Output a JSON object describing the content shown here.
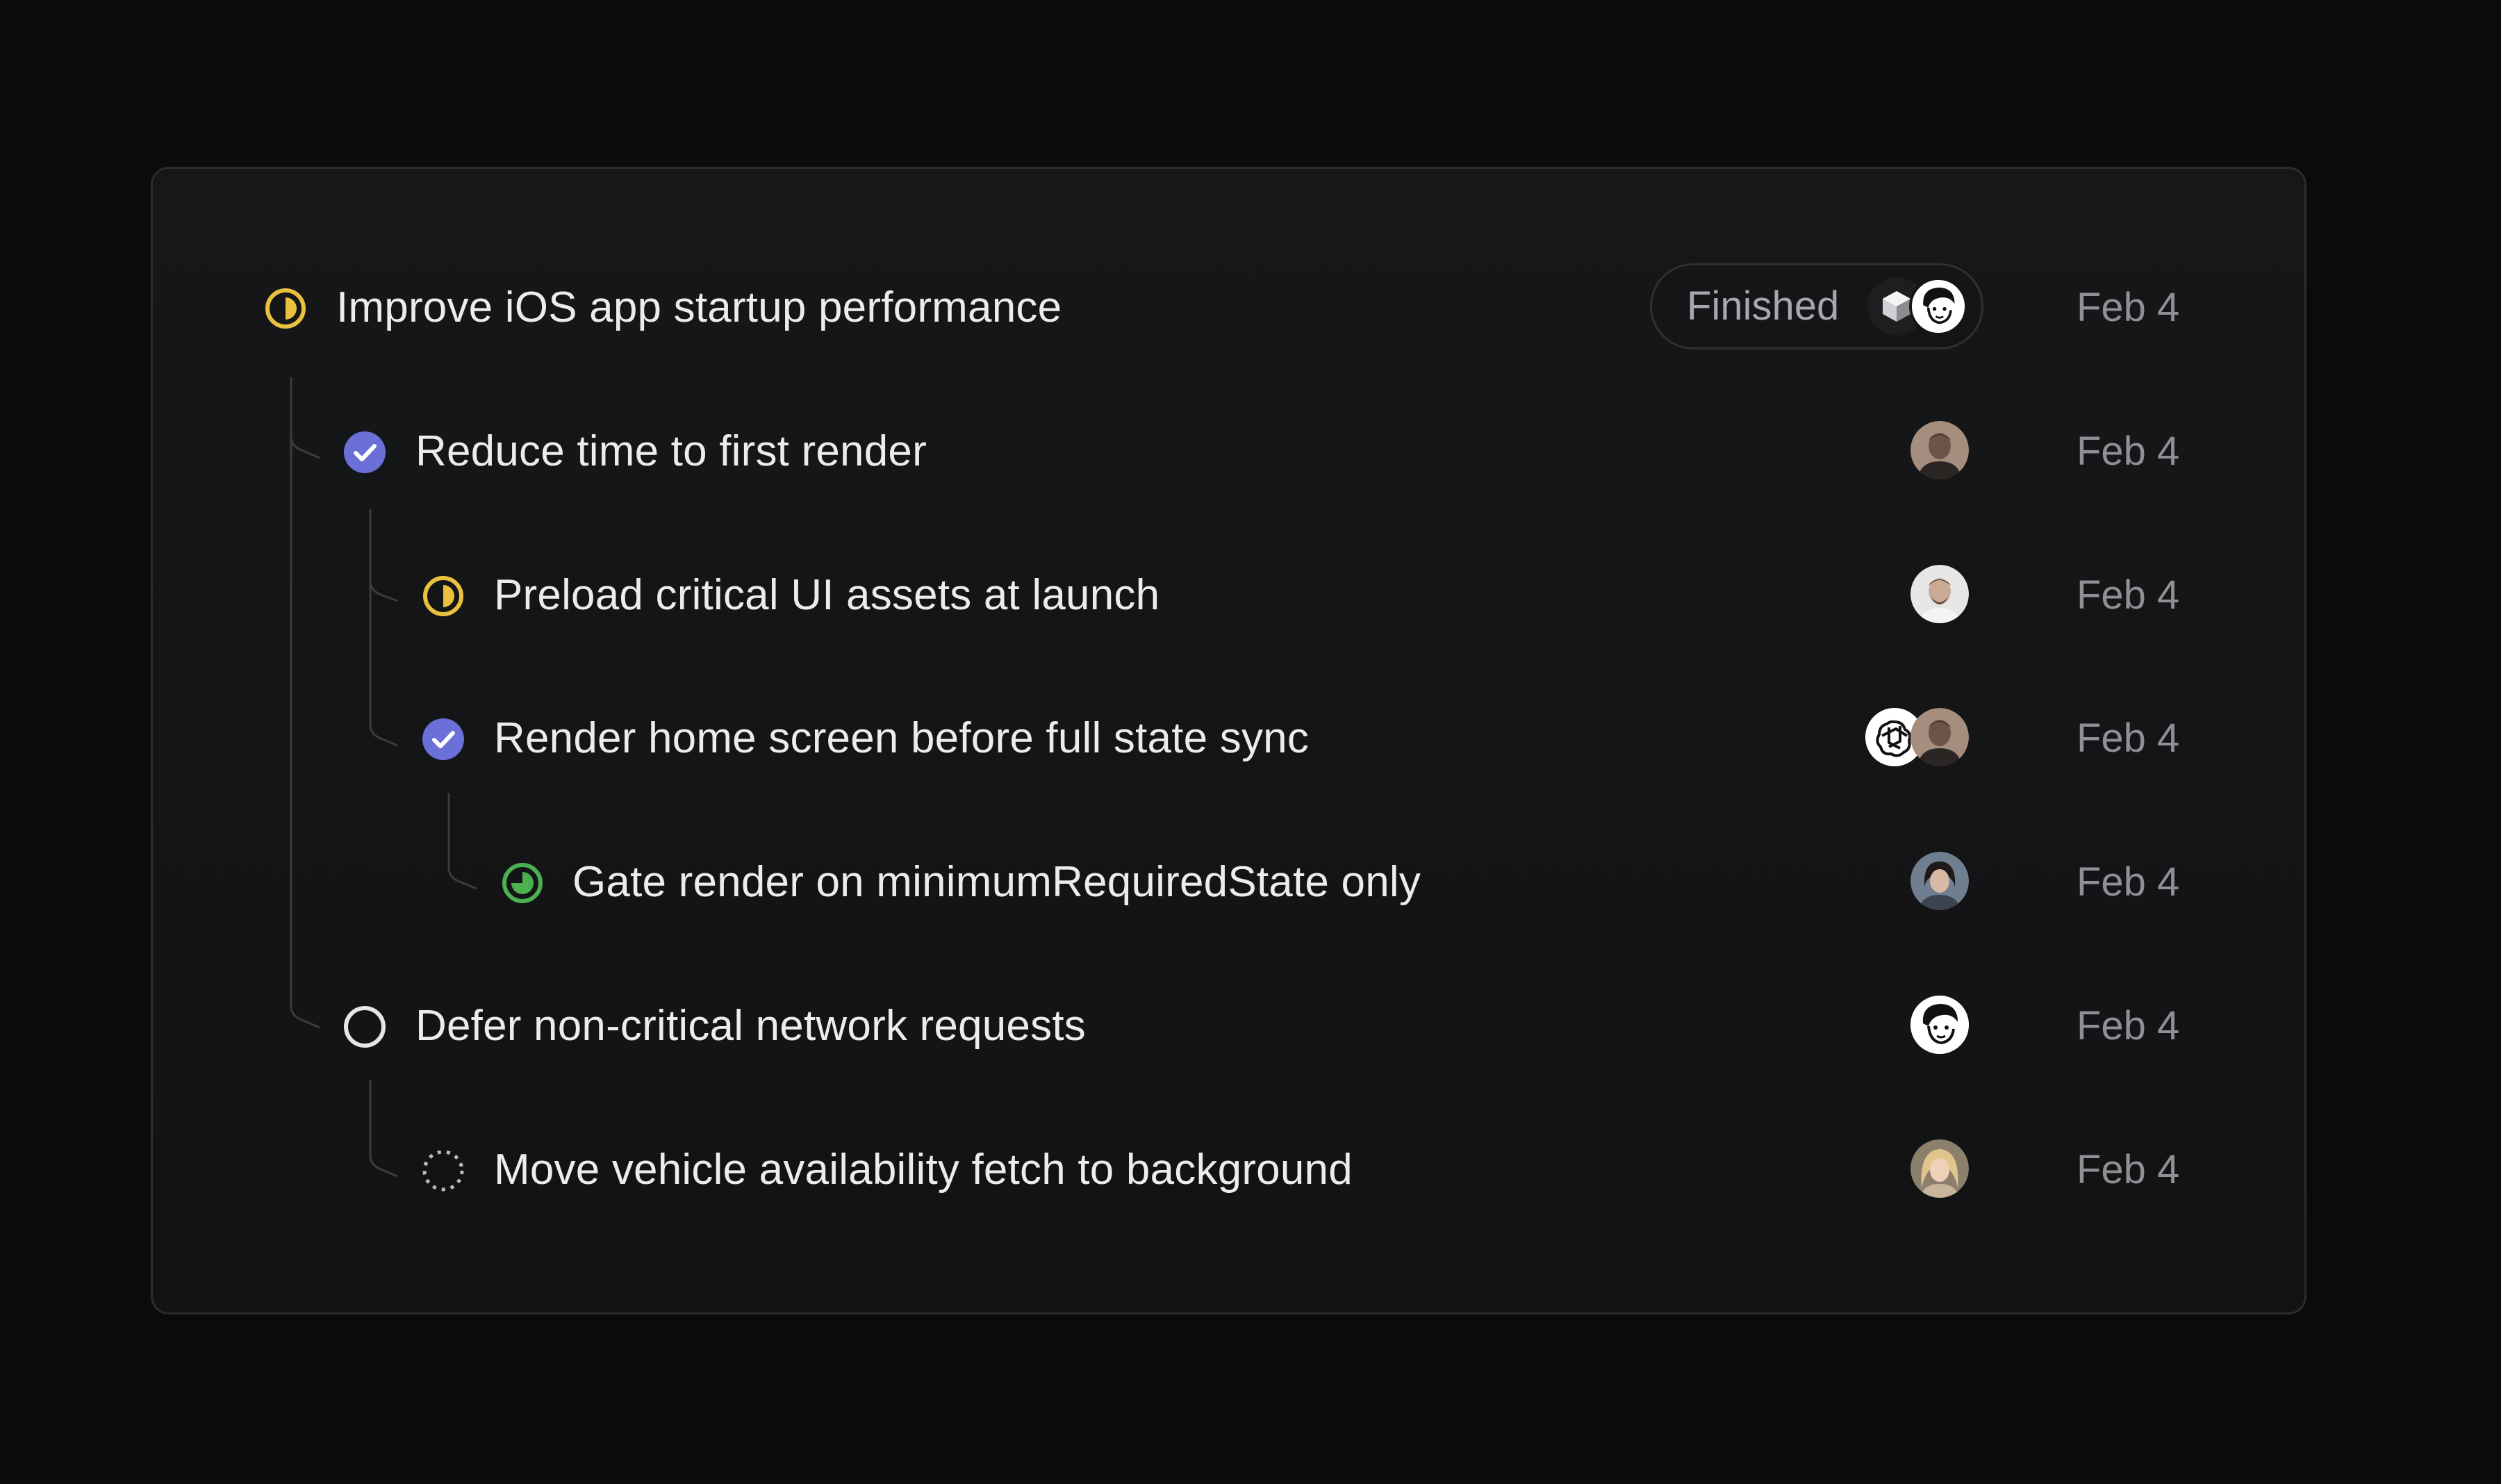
{
  "issues": [
    {
      "title": "Improve iOS app startup performance",
      "status": "in-progress",
      "date": "Feb 4",
      "badge": "Finished"
    },
    {
      "title": "Reduce time to first render",
      "status": "done",
      "date": "Feb 4"
    },
    {
      "title": "Preload critical UI assets at launch",
      "status": "in-progress",
      "date": "Feb 4"
    },
    {
      "title": "Render home screen before full state sync",
      "status": "done",
      "date": "Feb 4"
    },
    {
      "title": "Gate render on minimumRequiredState only",
      "status": "in-review",
      "date": "Feb 4"
    },
    {
      "title": "Defer non-critical network requests",
      "status": "todo",
      "date": "Feb 4"
    },
    {
      "title": "Move vehicle availability fetch to background",
      "status": "backlog",
      "date": "Feb 4"
    }
  ],
  "colors": {
    "in_progress": "#e9c13f",
    "done": "#6b6fd8",
    "in_review": "#4caf50",
    "todo": "#e6e6e8",
    "backlog": "#bdbdc0"
  }
}
